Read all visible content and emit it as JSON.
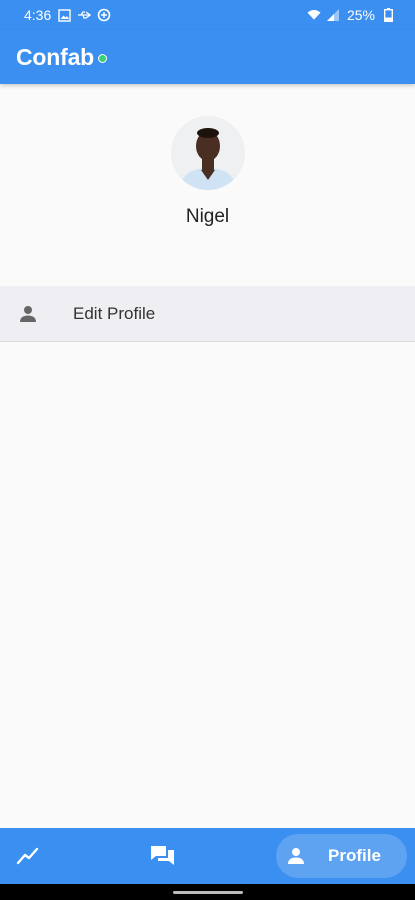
{
  "status_bar": {
    "time": "4:36",
    "battery": "25%",
    "icons": [
      "image-icon",
      "usb-icon",
      "data-saver-icon",
      "wifi-icon",
      "signal-icon",
      "battery-icon"
    ]
  },
  "app_bar": {
    "title": "Confab",
    "online_status_color": "#3cd070"
  },
  "profile": {
    "name": "Nigel",
    "avatar_icon": "user-photo"
  },
  "menu": {
    "items": [
      {
        "label": "Edit Profile",
        "icon": "person-icon"
      }
    ]
  },
  "bottom_nav": {
    "items": [
      {
        "icon": "trending-icon",
        "label": ""
      },
      {
        "icon": "chat-icon",
        "label": ""
      },
      {
        "icon": "person-icon",
        "label": "Profile",
        "active": true
      }
    ]
  },
  "colors": {
    "primary": "#3a8ff0",
    "background": "#fafafa",
    "menu_row": "#efeff3"
  }
}
